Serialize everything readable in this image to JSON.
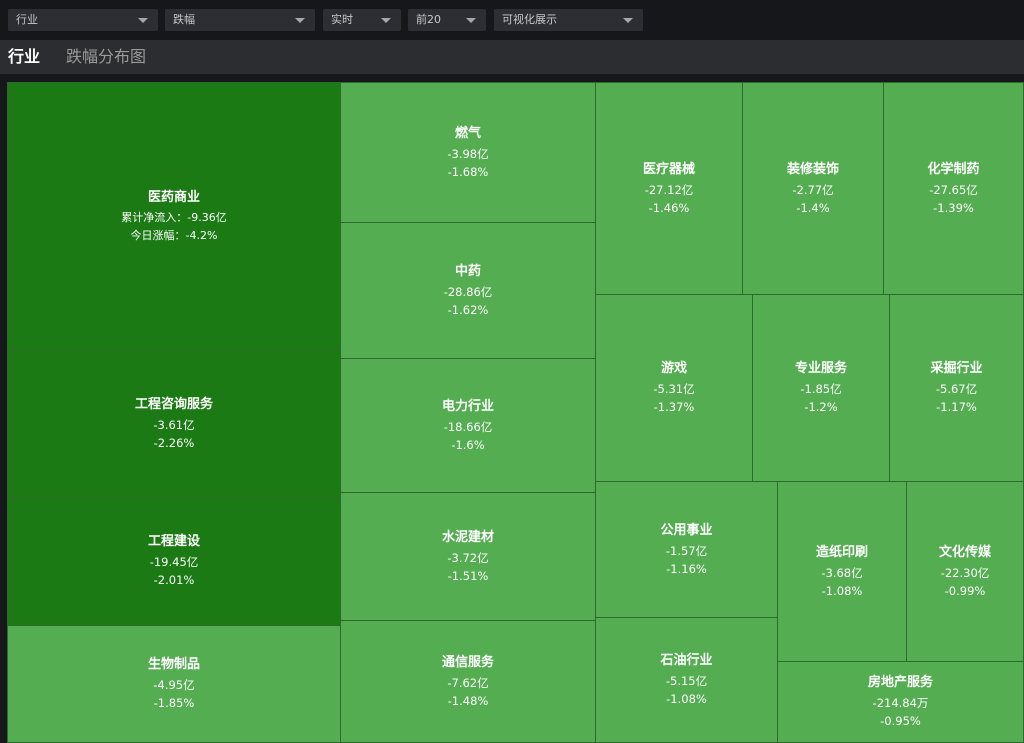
{
  "filters": [
    {
      "value": "行业"
    },
    {
      "value": "跌幅"
    },
    {
      "value": "实时"
    },
    {
      "value": "前20"
    },
    {
      "value": "可视化展示"
    }
  ],
  "tabs": [
    {
      "label": "行业"
    },
    {
      "label": "跌幅分布图"
    }
  ],
  "tooltip_labels": {
    "flow": "累计净流入：",
    "change": "今日涨幅："
  },
  "tiles": [
    {
      "name": "医药商业",
      "flow": "-9.36亿",
      "change": "-4.2%",
      "shade": "dark"
    },
    {
      "name": "工程咨询服务",
      "flow": "-3.61亿",
      "change": "-2.26%",
      "shade": "dark"
    },
    {
      "name": "工程建设",
      "flow": "-19.45亿",
      "change": "-2.01%",
      "shade": "dark"
    },
    {
      "name": "生物制品",
      "flow": "-4.95亿",
      "change": "-1.85%",
      "shade": "light"
    },
    {
      "name": "燃气",
      "flow": "-3.98亿",
      "change": "-1.68%",
      "shade": "light"
    },
    {
      "name": "中药",
      "flow": "-28.86亿",
      "change": "-1.62%",
      "shade": "light"
    },
    {
      "name": "电力行业",
      "flow": "-18.66亿",
      "change": "-1.6%",
      "shade": "light"
    },
    {
      "name": "水泥建材",
      "flow": "-3.72亿",
      "change": "-1.51%",
      "shade": "light"
    },
    {
      "name": "通信服务",
      "flow": "-7.62亿",
      "change": "-1.48%",
      "shade": "light"
    },
    {
      "name": "医疗器械",
      "flow": "-27.12亿",
      "change": "-1.46%",
      "shade": "light"
    },
    {
      "name": "装修装饰",
      "flow": "-2.77亿",
      "change": "-1.4%",
      "shade": "light"
    },
    {
      "name": "化学制药",
      "flow": "-27.65亿",
      "change": "-1.39%",
      "shade": "light"
    },
    {
      "name": "游戏",
      "flow": "-5.31亿",
      "change": "-1.37%",
      "shade": "light"
    },
    {
      "name": "专业服务",
      "flow": "-1.85亿",
      "change": "-1.2%",
      "shade": "light"
    },
    {
      "name": "采掘行业",
      "flow": "-5.67亿",
      "change": "-1.17%",
      "shade": "light"
    },
    {
      "name": "公用事业",
      "flow": "-1.57亿",
      "change": "-1.16%",
      "shade": "light"
    },
    {
      "name": "造纸印刷",
      "flow": "-3.68亿",
      "change": "-1.08%",
      "shade": "light"
    },
    {
      "name": "文化传媒",
      "flow": "-22.30亿",
      "change": "-0.99%",
      "shade": "light"
    },
    {
      "name": "石油行业",
      "flow": "-5.15亿",
      "change": "-1.08%",
      "shade": "light"
    },
    {
      "name": "房地产服务",
      "flow": "-214.84万",
      "change": "-0.95%",
      "shade": "light"
    }
  ],
  "colors": {
    "dark_tile": "#1b7a14",
    "light_tile": "#55ad52",
    "background": "#16171b",
    "tabbar": "#2b2d31",
    "select": "#2c2e33"
  }
}
